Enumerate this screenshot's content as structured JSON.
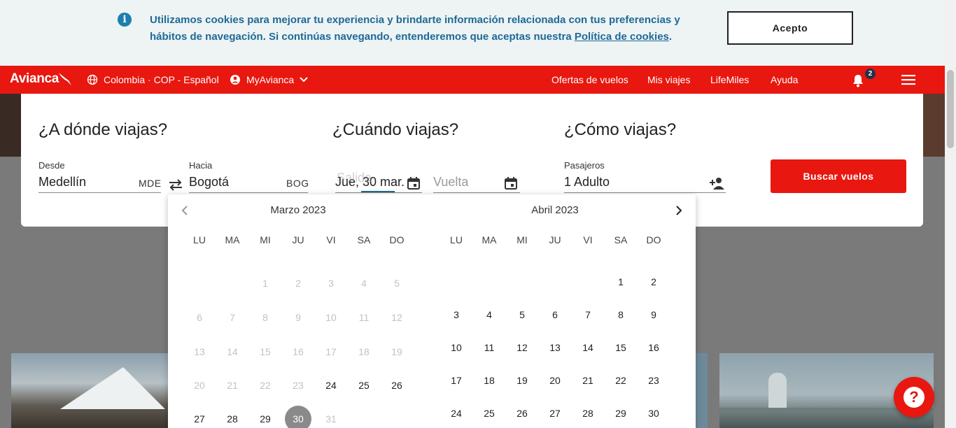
{
  "cookie_banner": {
    "message": "Utilizamos cookies para mejorar tu experiencia y brindarte información relacionada con tus preferencias y hábitos de navegación. Si continúas navegando, entenderemos que aceptas nuestra ",
    "policy_link": "Política de cookies",
    "suffix": ".",
    "accept_label": "Acepto"
  },
  "nav": {
    "logo": "Avianca",
    "region": "Colombia · COP - Español",
    "account": "MyAvianca",
    "links": [
      "Ofertas de vuelos",
      "Mis viajes",
      "LifeMiles",
      "Ayuda"
    ],
    "notification_count": "2",
    "colors": {
      "brand_red": "#e8170f",
      "badge": "#23304a"
    }
  },
  "search": {
    "where_title": "¿A dónde viajas?",
    "when_title": "¿Cuándo viajas?",
    "how_title": "¿Cómo viajas?",
    "from_label": "Desde",
    "from_value": "Medellín",
    "from_code": "MDE",
    "to_label": "Hacia",
    "to_value": "Bogotá",
    "to_code": "BOG",
    "depart_value": "Jue, 30 mar.",
    "depart_label_overlap": "Salida",
    "return_placeholder": "Vuelta",
    "passengers_label": "Pasajeros",
    "passengers_value": "1 Adulto",
    "search_button": "Buscar vuelos"
  },
  "calendar": {
    "weekdays": [
      "LU",
      "MA",
      "MI",
      "JU",
      "VI",
      "SA",
      "DO"
    ],
    "months": [
      {
        "title": "Marzo 2023",
        "weeks": [
          [
            null,
            null,
            {
              "d": "1",
              "s": "disabled"
            },
            {
              "d": "2",
              "s": "disabled"
            },
            {
              "d": "3",
              "s": "disabled"
            },
            {
              "d": "4",
              "s": "disabled"
            },
            {
              "d": "5",
              "s": "disabled"
            }
          ],
          [
            {
              "d": "6",
              "s": "disabled"
            },
            {
              "d": "7",
              "s": "disabled"
            },
            {
              "d": "8",
              "s": "disabled"
            },
            {
              "d": "9",
              "s": "disabled"
            },
            {
              "d": "10",
              "s": "disabled"
            },
            {
              "d": "11",
              "s": "disabled"
            },
            {
              "d": "12",
              "s": "disabled"
            }
          ],
          [
            {
              "d": "13",
              "s": "disabled"
            },
            {
              "d": "14",
              "s": "disabled"
            },
            {
              "d": "15",
              "s": "disabled"
            },
            {
              "d": "16",
              "s": "disabled"
            },
            {
              "d": "17",
              "s": "disabled"
            },
            {
              "d": "18",
              "s": "disabled"
            },
            {
              "d": "19",
              "s": "disabled"
            }
          ],
          [
            {
              "d": "20",
              "s": "disabled"
            },
            {
              "d": "21",
              "s": "disabled"
            },
            {
              "d": "22",
              "s": "disabled"
            },
            {
              "d": "23",
              "s": "disabled"
            },
            {
              "d": "24",
              "s": "enabled"
            },
            {
              "d": "25",
              "s": "enabled"
            },
            {
              "d": "26",
              "s": "enabled"
            }
          ],
          [
            {
              "d": "27",
              "s": "enabled"
            },
            {
              "d": "28",
              "s": "enabled"
            },
            {
              "d": "29",
              "s": "enabled"
            },
            {
              "d": "30",
              "s": "selected"
            },
            {
              "d": "31",
              "s": "disabled"
            },
            null,
            null
          ]
        ]
      },
      {
        "title": "Abril 2023",
        "weeks": [
          [
            null,
            null,
            null,
            null,
            null,
            {
              "d": "1",
              "s": "enabled"
            },
            {
              "d": "2",
              "s": "enabled"
            }
          ],
          [
            {
              "d": "3",
              "s": "enabled"
            },
            {
              "d": "4",
              "s": "enabled"
            },
            {
              "d": "5",
              "s": "enabled"
            },
            {
              "d": "6",
              "s": "enabled"
            },
            {
              "d": "7",
              "s": "enabled"
            },
            {
              "d": "8",
              "s": "enabled"
            },
            {
              "d": "9",
              "s": "enabled"
            }
          ],
          [
            {
              "d": "10",
              "s": "enabled"
            },
            {
              "d": "11",
              "s": "enabled"
            },
            {
              "d": "12",
              "s": "enabled"
            },
            {
              "d": "13",
              "s": "enabled"
            },
            {
              "d": "14",
              "s": "enabled"
            },
            {
              "d": "15",
              "s": "enabled"
            },
            {
              "d": "16",
              "s": "enabled"
            }
          ],
          [
            {
              "d": "17",
              "s": "enabled"
            },
            {
              "d": "18",
              "s": "enabled"
            },
            {
              "d": "19",
              "s": "enabled"
            },
            {
              "d": "20",
              "s": "enabled"
            },
            {
              "d": "21",
              "s": "enabled"
            },
            {
              "d": "22",
              "s": "enabled"
            },
            {
              "d": "23",
              "s": "enabled"
            }
          ],
          [
            {
              "d": "24",
              "s": "enabled"
            },
            {
              "d": "25",
              "s": "enabled"
            },
            {
              "d": "26",
              "s": "enabled"
            },
            {
              "d": "27",
              "s": "enabled"
            },
            {
              "d": "28",
              "s": "enabled"
            },
            {
              "d": "29",
              "s": "enabled"
            },
            {
              "d": "30",
              "s": "enabled"
            }
          ]
        ]
      }
    ]
  },
  "help": {
    "icon": "question-icon"
  }
}
